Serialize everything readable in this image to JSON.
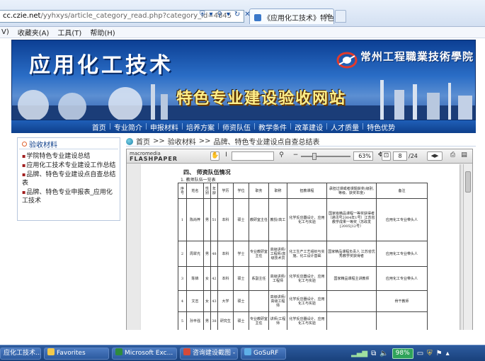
{
  "browser": {
    "url_domain": "cc.czie.net",
    "url_rest": "/yyhxys/article_category_read.php?category_id=4845",
    "tab_title": "《应用化工技术》特色专...",
    "tab_close": "×",
    "menus": [
      "V)",
      "收藏夹(A)",
      "工具(T)",
      "帮助(H)"
    ]
  },
  "banner": {
    "title": "应用化工技术",
    "school": "常州工程職業技術學院",
    "subtitle": "特色专业建设验收网站"
  },
  "nav": {
    "items": [
      "首页",
      "专业简介",
      "申报材料",
      "培养方案",
      "师资队伍",
      "教学条件",
      "改革建设",
      "人才质量",
      "特色优势"
    ]
  },
  "sidebar": {
    "heading": "验收材料",
    "items": [
      "学院特色专业建设总结",
      "应用化工技术专业建设工作总结",
      "品牌、特色专业建设点自查总结表",
      "品牌、特色专业申报表_应用化工技术"
    ]
  },
  "breadcrumb": {
    "home": "首页",
    "sep": ">>",
    "level1": "验收材料",
    "level2": "品牌、特色专业建设点自查总结表"
  },
  "viewer": {
    "logo_top": "macromedia",
    "logo_bottom": "FLASHPAPER",
    "zoom": "63%",
    "page": "8",
    "page_total": "/24"
  },
  "document": {
    "heading": "四、  师资队伍情况",
    "subheading": "1. 教师队伍一览表",
    "columns": [
      "序号",
      "姓名",
      "性别",
      "年龄",
      "学历",
      "学位",
      "职务",
      "职称",
      "担教课程",
      "承担过课或者课题获奖(级别,等级、获奖年度)",
      "备注"
    ],
    "rows": [
      [
        "1",
        "陈尚梓",
        "男",
        "51",
        "本科",
        "硕士",
        "教研室主任",
        "教授/高工",
        "化学反应器设计、应用化工与实验",
        "国家级精品课程一等奖获得者（通讯号2004年1号）江苏省教学成果一等奖（苏政发[2005]12号）",
        "应用化工专业带头人"
      ],
      [
        "2",
        "周翠光",
        "男",
        "48",
        "本科",
        "学士",
        "专业教研室主任",
        "高级讲师/工程师/高级技术员",
        "化工生产工艺组织与实施、化工设计基础",
        "国家精品课程负责人  江苏省优秀教学奖获得者",
        "应用化工专业带头人"
      ],
      [
        "3",
        "陈锦",
        "女",
        "42",
        "本科",
        "硕士",
        "系副主任",
        "高级讲师/工程师",
        "化学反应器设计、应用化工与实验",
        "国家精品课程主讲教师",
        "应用化工专业带头人"
      ],
      [
        "4",
        "文志",
        "女",
        "43",
        "大学",
        "硕士",
        "",
        "高级讲师/高级工程师",
        "化学反应器设计、应用化工与实验",
        "",
        "骨干教师"
      ],
      [
        "5",
        "孙丰强",
        "男",
        "38",
        "研究生",
        "硕士",
        "专业教研室主任",
        "讲师/工程师",
        "化学反应器设计、应用化工与实验",
        "",
        ""
      ]
    ]
  },
  "taskbar": {
    "items": [
      "应化工技术...",
      "Favorites",
      "Microsoft Exc...",
      "咨询建设截图 - ...",
      "GoSuRF"
    ],
    "battery": "98%"
  },
  "colors": {
    "banner_blue": "#0c3f93",
    "nav_blue": "#0e3f8b",
    "subtitle_gold": "#ffef8a"
  }
}
